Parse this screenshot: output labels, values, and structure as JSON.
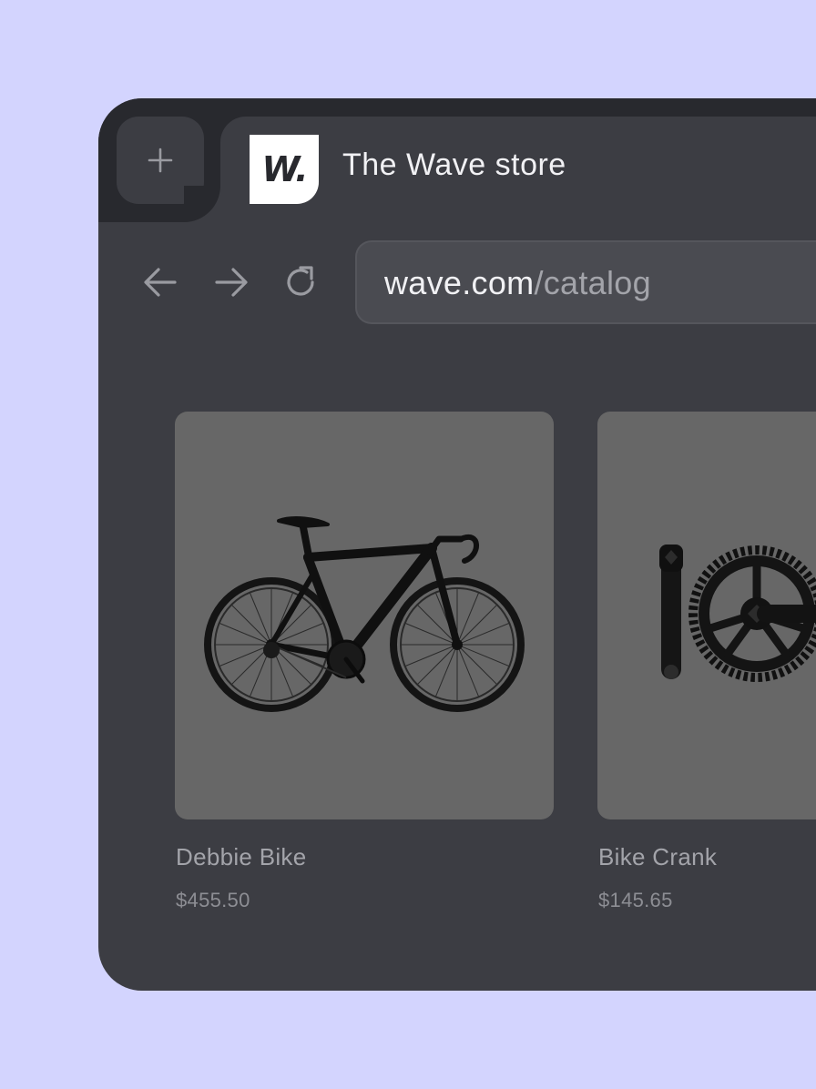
{
  "tab": {
    "favicon_text": "W.",
    "title": "The Wave store"
  },
  "address_bar": {
    "domain": "wave.com",
    "path": "/catalog"
  },
  "products": [
    {
      "name": "Debbie Bike",
      "price": "$455.50",
      "image": "road-bike"
    },
    {
      "name": "Bike Crank",
      "price": "$145.65",
      "image": "bike-crank"
    }
  ],
  "icons": {
    "new_tab": "plus-icon",
    "back": "arrow-left-icon",
    "forward": "arrow-right-icon",
    "reload": "reload-icon"
  },
  "colors": {
    "page_background": "#d3d4fe",
    "window": "#3c3d43",
    "tabstrip": "#28292e",
    "address_bar": "#4a4b51",
    "product_card": "#676767"
  }
}
